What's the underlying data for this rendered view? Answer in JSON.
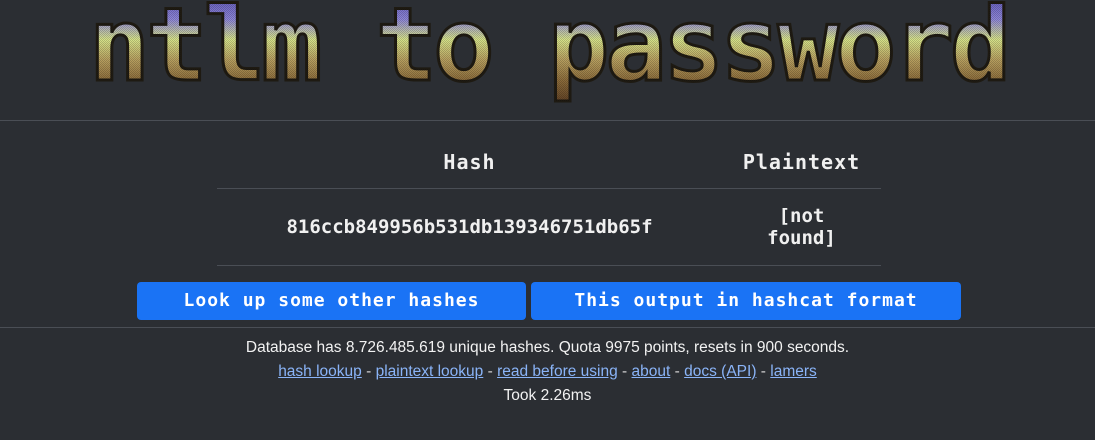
{
  "banner": {
    "title": "ntlm to password",
    "colors": {
      "top": "#4b42a6",
      "upper": "#8e86d8",
      "middle": "#d7e38a",
      "lower": "#8a6a3a",
      "bottom": "#5a3b22",
      "outline": "#1e1a12"
    }
  },
  "table": {
    "headers": [
      "Hash",
      "Plaintext"
    ],
    "rows": [
      {
        "hash": "816ccb849956b531db139346751db65f",
        "plaintext_line1": "[not",
        "plaintext_line2": "found]"
      }
    ]
  },
  "buttons": {
    "lookup": "Look up some other hashes",
    "hashcat": "This output in hashcat format"
  },
  "footer": {
    "stats": "Database has 8.726.485.619 unique hashes. Quota 9975 points, resets in 900 seconds.",
    "links": [
      "hash lookup",
      "plaintext lookup",
      "read before using",
      "about",
      "docs (API)",
      "lamers"
    ],
    "separator": "-",
    "timing": "Took 2.26ms"
  },
  "colors": {
    "background": "#2b2e33",
    "button": "#1a73f5",
    "link": "#8ab4f8",
    "divider": "#4a4e55"
  }
}
